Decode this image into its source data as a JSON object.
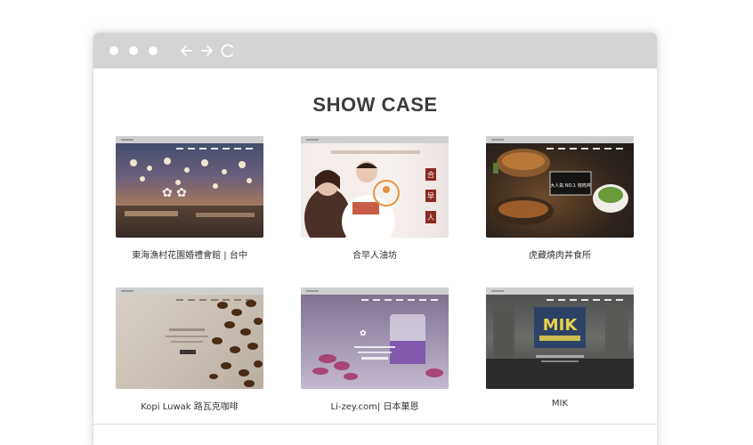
{
  "browser": {
    "window_controls": [
      "dot",
      "dot",
      "dot"
    ],
    "nav_icons": [
      "back-arrow-icon",
      "forward-arrow-icon",
      "reload-icon"
    ]
  },
  "section": {
    "title": "SHOW CASE"
  },
  "cases": [
    {
      "caption": "東海漁村花園婚禮會館 | 台中"
    },
    {
      "caption": "合早人油坊"
    },
    {
      "caption": "虎藏燒肉丼食所"
    },
    {
      "caption": "Kopi Luwak 路瓦克咖啡"
    },
    {
      "caption": "Li-zey.com| 日本菓恩"
    },
    {
      "caption": "MIK"
    }
  ],
  "thumb_text": {
    "case2_chars": [
      "合",
      "早",
      "人"
    ],
    "case3_line1": "大人氣 NO.1 燒肉丼",
    "case6_logo": "MIK"
  },
  "colors": {
    "titlebar": "#d3d4d6",
    "heading": "#3c3c3c",
    "caption": "#333333"
  }
}
